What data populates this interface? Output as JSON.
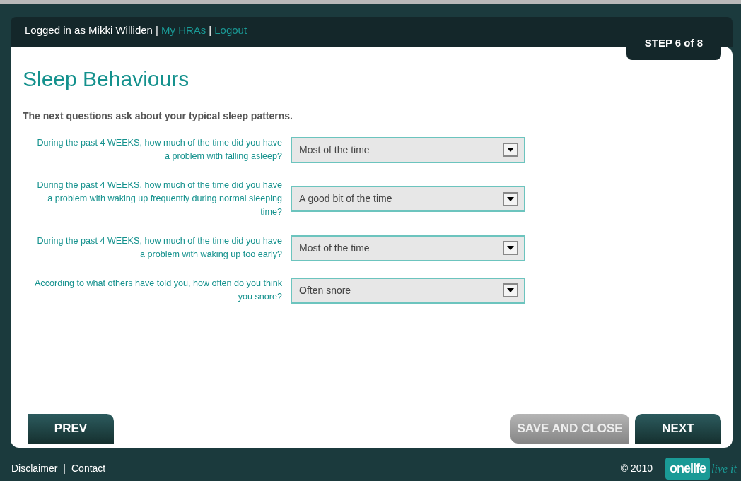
{
  "header": {
    "logged_in_text": "Logged in as Mikki Williden |",
    "links": [
      {
        "label": "My HRAs"
      },
      {
        "label": "Logout"
      }
    ],
    "separator": "|",
    "step": "STEP 6 of 8"
  },
  "title": "Sleep Behaviours",
  "intro": "The next questions ask about your typical sleep patterns.",
  "questions": [
    {
      "label": "During the past 4 WEEKS, how much of the time did you have a problem with falling asleep?",
      "value": "Most of the time"
    },
    {
      "label": "During the past 4 WEEKS, how much of the time did you have a problem with waking up frequently during normal sleeping time?",
      "value": "A good bit of the time"
    },
    {
      "label": "During the past 4 WEEKS, how much of the time did you have a problem with waking up too early?",
      "value": "Most of the time"
    },
    {
      "label": "According to what others have told you, how often do you think you snore?",
      "value": "Often snore"
    }
  ],
  "buttons": [
    {
      "kind": "prev",
      "label": "PREV"
    },
    {
      "kind": "save",
      "label": "SAVE AND CLOSE"
    },
    {
      "kind": "next",
      "label": "NEXT"
    }
  ],
  "footer": {
    "links": [
      {
        "label": "Disclaimer"
      },
      {
        "label": "Contact"
      }
    ],
    "separator": "|",
    "copyright": "© 2010",
    "logo": {
      "name": "onelife",
      "tagline": "live it"
    }
  }
}
